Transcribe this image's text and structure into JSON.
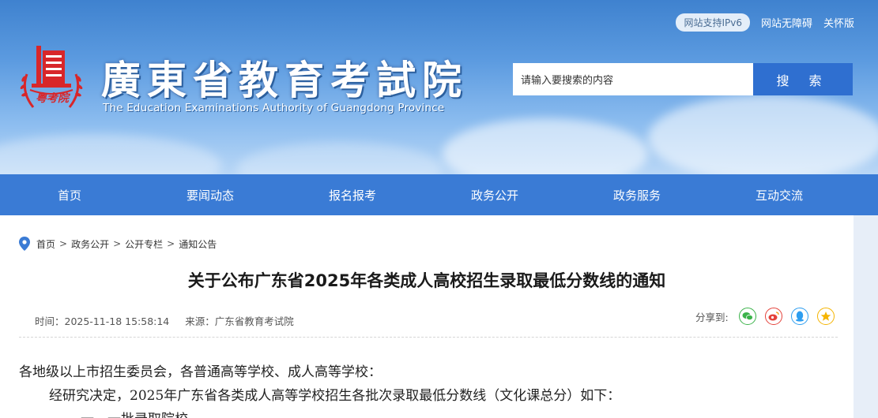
{
  "header": {
    "ipv6_label": "网站支持IPv6",
    "accessibility_label": "网站无障碍",
    "care_label": "关怀版",
    "title_cn": "廣東省教育考試院",
    "title_en": "The Education Examinations Authority of Guangdong Province",
    "logo_text": "粤考院",
    "search_placeholder": "请输入要搜索的内容",
    "search_button": "搜 索"
  },
  "nav": {
    "items": [
      {
        "label": "首页"
      },
      {
        "label": "要闻动态"
      },
      {
        "label": "报名报考"
      },
      {
        "label": "政务公开"
      },
      {
        "label": "政务服务"
      },
      {
        "label": "互动交流"
      }
    ]
  },
  "breadcrumb": {
    "items": [
      "首页",
      "政务公开",
      "公开专栏",
      "通知公告"
    ],
    "separator": ">"
  },
  "article": {
    "title": "关于公布广东省2025年各类成人高校招生录取最低分数线的通知",
    "time": "时间：2025-11-18 15:58:14",
    "source": "来源：广东省教育考试院",
    "share_label": "分享到:",
    "share_icons": [
      "wechat-icon",
      "weibo-icon",
      "qq-icon",
      "qzone-icon"
    ],
    "paragraphs": [
      "各地级以上市招生委员会，各普通高等学校、成人高等学校：",
      "经研究决定，2025年广东省各类成人高等学校招生各批次录取最低分数线（文化课总分）如下：",
      "一、一批录取院校"
    ]
  },
  "colors": {
    "nav_bg": "#3a7bd5",
    "search_button_bg": "#2f6fd0",
    "logo_red": "#d8262a"
  }
}
